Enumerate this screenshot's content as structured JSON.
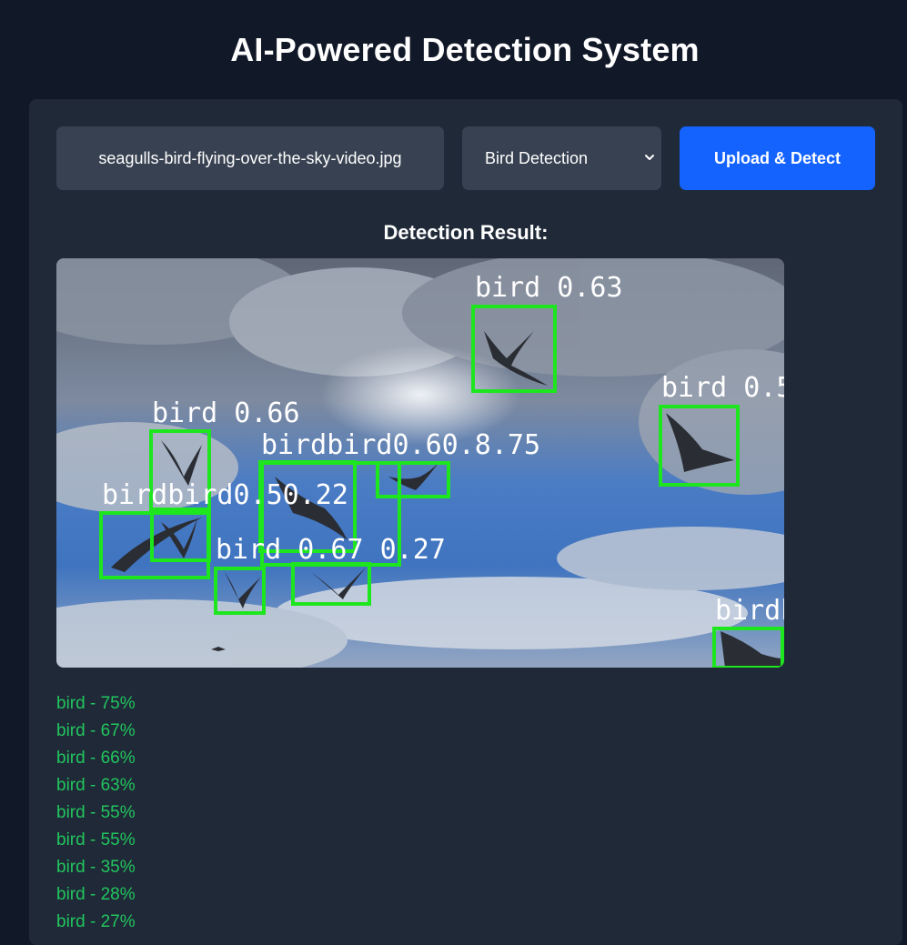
{
  "app": {
    "title": "AI-Powered Detection System"
  },
  "controls": {
    "file_name": "seagulls-bird-flying-over-the-sky-video.jpg",
    "model_selected": "Bird Detection",
    "upload_label": "Upload & Detect"
  },
  "result": {
    "heading": "Detection Result:",
    "image_labels": [
      "bird 0.63",
      "bird 0.5",
      "bird 0.66",
      "birdbird0.60.8.75",
      "birdbird0.50.22",
      "bird 0.67 0.27",
      "birdb"
    ],
    "box_color": "#1ee61e",
    "label_color": "#ffffff"
  },
  "detections": [
    "bird - 75%",
    "bird - 67%",
    "bird - 66%",
    "bird - 63%",
    "bird - 55%",
    "bird - 55%",
    "bird - 35%",
    "bird - 28%",
    "bird - 27%"
  ],
  "colors": {
    "page_bg": "#111827",
    "card_bg": "#1f2937",
    "field_bg": "#374151",
    "accent": "#1463ff",
    "detection_text": "#22c55e"
  },
  "icons": {
    "select_arrow": "chevron-down-icon"
  }
}
